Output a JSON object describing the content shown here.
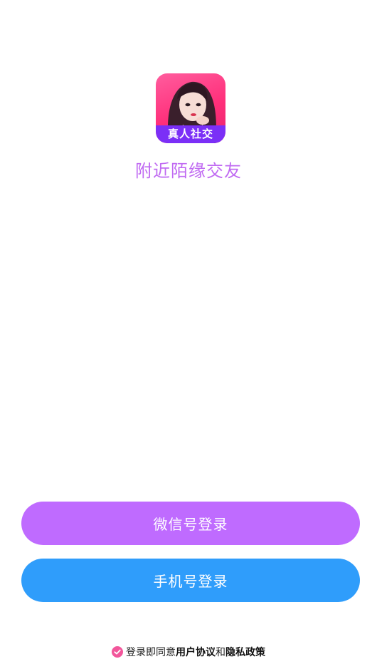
{
  "app": {
    "icon_banner_text": "真人社交",
    "title": "附近陌缘交友",
    "icon_name": "app-logo-icon"
  },
  "login": {
    "wechat_label": "微信号登录",
    "phone_label": "手机号登录"
  },
  "agreement": {
    "prefix": "登录即同意",
    "user_agreement": "用户协议",
    "connector": "和",
    "privacy_policy": "隐私政策",
    "checked": true
  },
  "colors": {
    "title": "#c06af2",
    "wechat_button": "#bf6bff",
    "phone_button": "#2f9dfb",
    "check": "#f2569b",
    "icon_banner": "#7b2ff7"
  }
}
